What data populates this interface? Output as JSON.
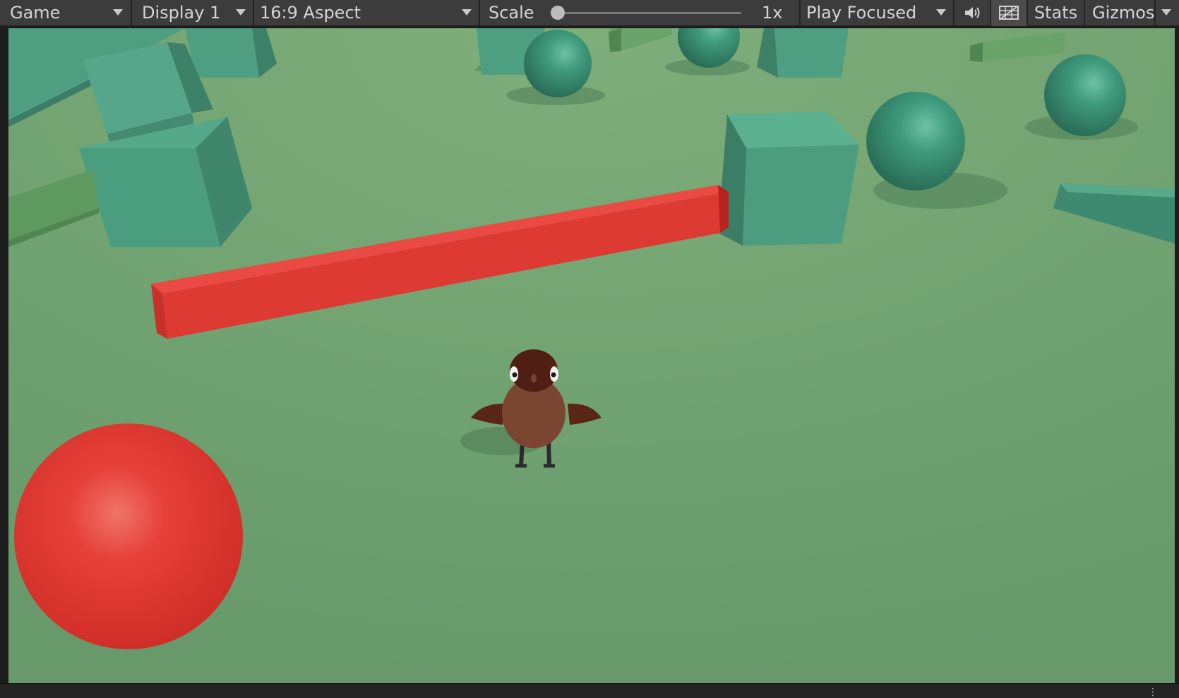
{
  "toolbar": {
    "view_label": "Game",
    "display_label": "Display 1",
    "aspect_label": "16:9 Aspect",
    "scale_label": "Scale",
    "scale_value": "1x",
    "scale_fraction": 0.0,
    "play_mode_label": "Play Focused",
    "stats_label": "Stats",
    "gizmos_label": "Gizmos"
  },
  "icons": {
    "audio": "speaker-icon",
    "stats_overlay": "grid-overlay-icon"
  },
  "colors": {
    "ground": "#6ea06b",
    "teal_objects": "#4e9e82",
    "red_objects": "#e03c34",
    "bird_body": "#7a4632"
  }
}
